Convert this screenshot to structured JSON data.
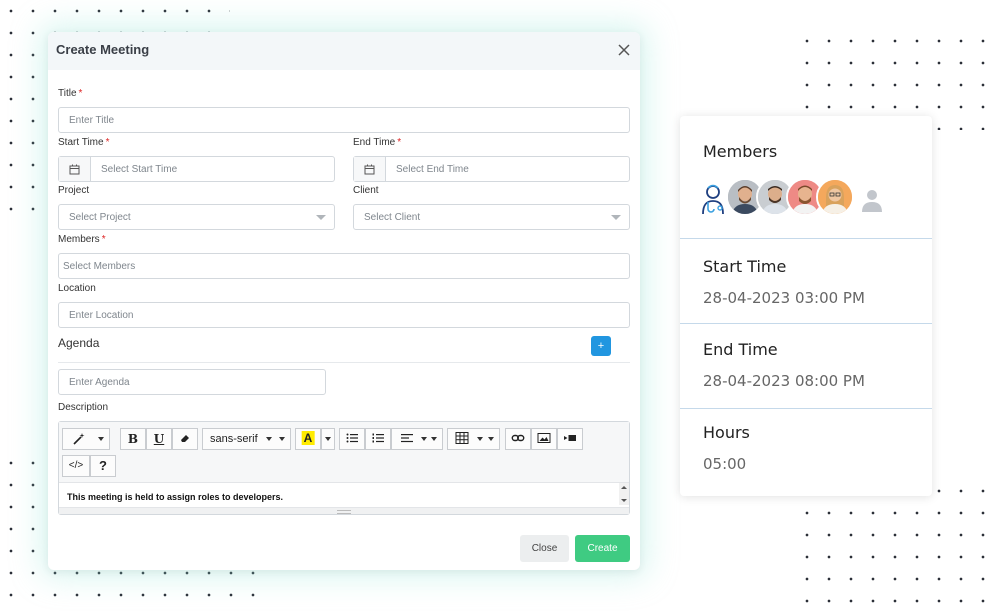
{
  "modal": {
    "title": "Create Meeting",
    "fields": {
      "title_label": "Title",
      "title_placeholder": "Enter Title",
      "start_label": "Start Time",
      "start_placeholder": "Select Start Time",
      "end_label": "End Time",
      "end_placeholder": "Select End Time",
      "project_label": "Project",
      "project_placeholder": "Select Project",
      "client_label": "Client",
      "client_placeholder": "Select Client",
      "members_label": "Members",
      "members_placeholder": "Select Members",
      "location_label": "Location",
      "location_placeholder": "Enter Location",
      "agenda_title": "Agenda",
      "agenda_add": "+",
      "agenda_placeholder": "Enter Agenda",
      "description_label": "Description",
      "required_mark": "*"
    },
    "editor": {
      "font_name": "sans-serif",
      "bold": "B",
      "underline": "U",
      "highlight": "A",
      "code": "</>",
      "help": "?",
      "content": "This meeting is held to assign roles to developers."
    },
    "buttons": {
      "close": "Close",
      "create": "Create"
    }
  },
  "card": {
    "members_title": "Members",
    "start_title": "Start Time",
    "start_value": "28-04-2023 03:00 PM",
    "end_title": "End Time",
    "end_value": "28-04-2023 08:00 PM",
    "hours_title": "Hours",
    "hours_value": "05:00"
  },
  "colors": {
    "primary": "#2196e0",
    "create": "#3fcb82",
    "required": "#d22222"
  }
}
